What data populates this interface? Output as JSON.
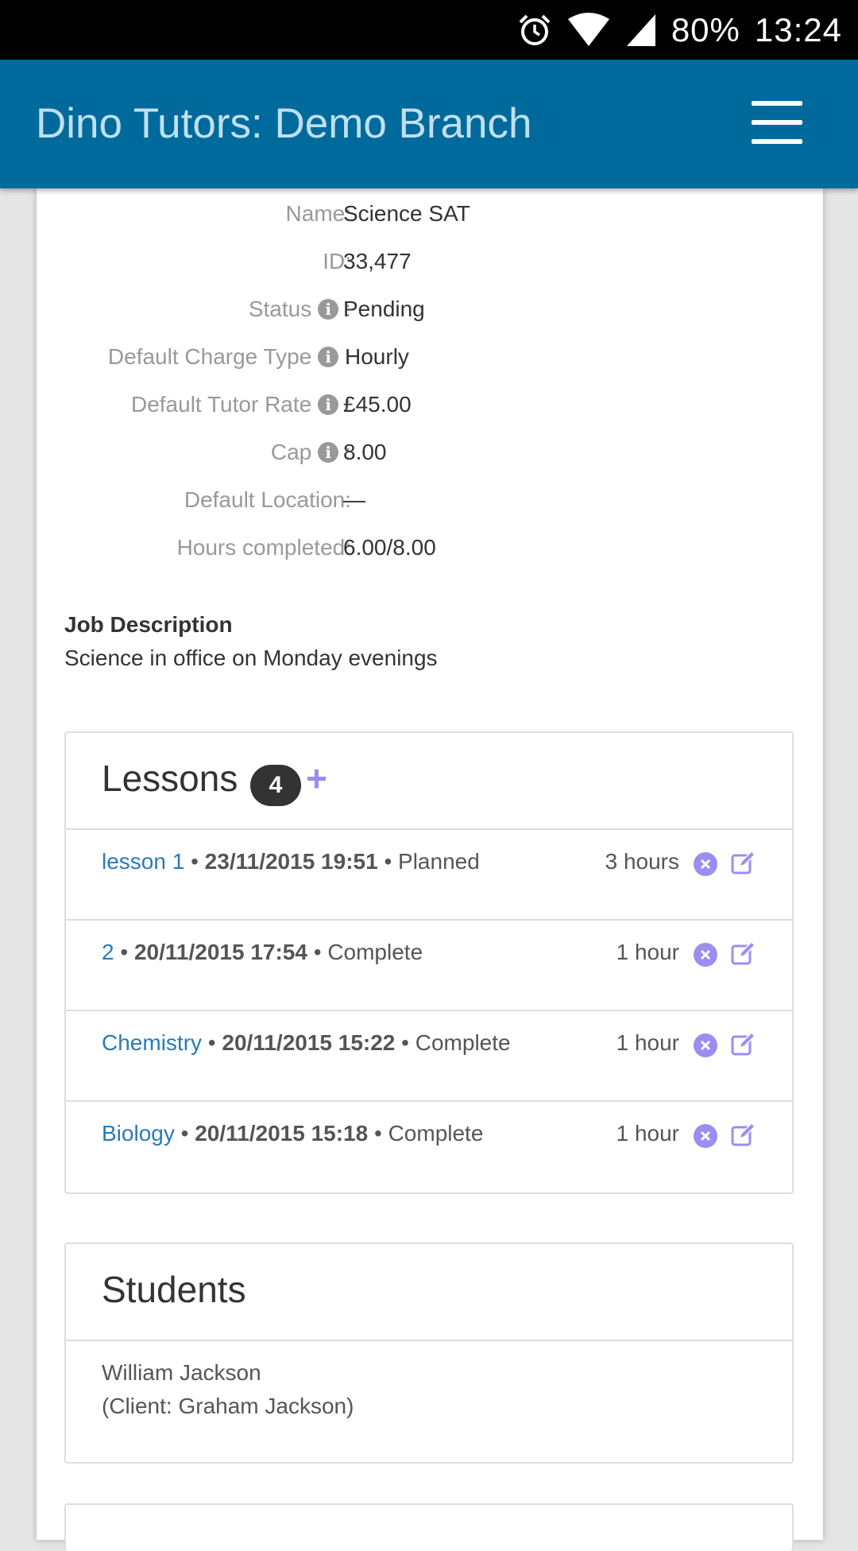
{
  "statusbar": {
    "battery": "80%",
    "time": "13:24"
  },
  "appbar": {
    "title": "Dino Tutors: Demo Branch"
  },
  "details": [
    {
      "label": "Name:",
      "value": "Science SAT",
      "info": false
    },
    {
      "label": "ID:",
      "value": "33,477",
      "info": false
    },
    {
      "label": "Status",
      "suffix": ":",
      "value": "Pending",
      "info": true
    },
    {
      "label": "Default Charge Type",
      "suffix": ":",
      "value": "Hourly",
      "info": true
    },
    {
      "label": "Default Tutor Rate",
      "suffix": ":",
      "value": "£45.00",
      "info": true
    },
    {
      "label": "Cap",
      "suffix": ":",
      "value": "8.00",
      "info": true
    },
    {
      "label": "Default Location:",
      "value": "—",
      "info": false
    },
    {
      "label": "Hours completed:",
      "value": "6.00/8.00",
      "info": false
    }
  ],
  "job": {
    "heading": "Job Description",
    "text": "Science in office on Monday evenings"
  },
  "lessons": {
    "title": "Lessons",
    "count": "4",
    "add": "+",
    "items": [
      {
        "name": "lesson 1",
        "date": "23/11/2015 19:51",
        "status": "Planned",
        "duration": "3 hours"
      },
      {
        "name": "2",
        "date": "20/11/2015 17:54",
        "status": "Complete",
        "duration": "1 hour"
      },
      {
        "name": "Chemistry",
        "date": "20/11/2015 15:22",
        "status": "Complete",
        "duration": "1 hour"
      },
      {
        "name": "Biology",
        "date": "20/11/2015 15:18",
        "status": "Complete",
        "duration": "1 hour"
      }
    ]
  },
  "students": {
    "title": "Students",
    "name": "William Jackson",
    "client": "(Client: Graham Jackson)"
  },
  "colors": {
    "appbar": "#016a9c",
    "link": "#2a7ab8",
    "accent": "#9a8ef0"
  }
}
